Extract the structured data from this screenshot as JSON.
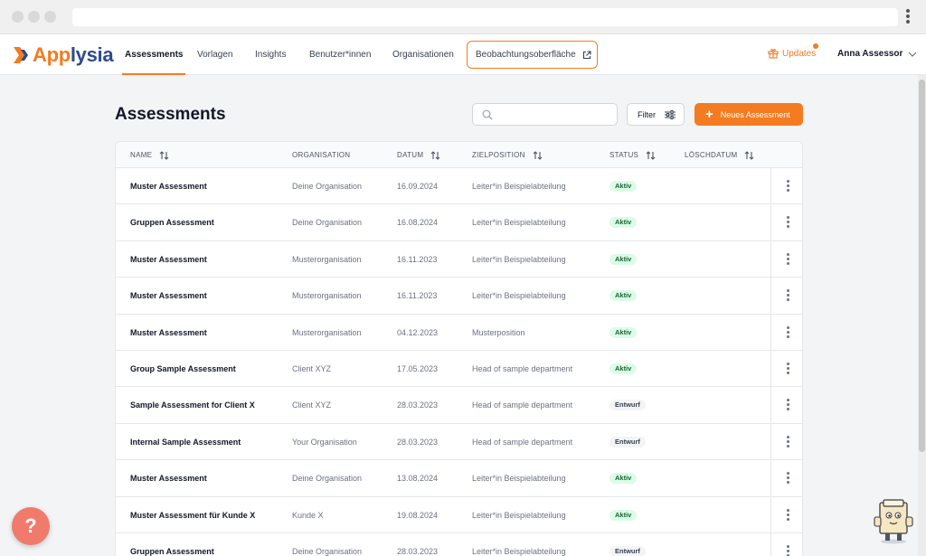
{
  "app": {
    "brand_part1": "App",
    "brand_part2": "lysia",
    "accent_color": "#f47b20",
    "brand_blue": "#2e4a8e"
  },
  "nav": {
    "items": [
      {
        "label": "Assessments",
        "active": true
      },
      {
        "label": "Vorlagen"
      },
      {
        "label": "Insights"
      },
      {
        "label": "Benutzer*innen"
      },
      {
        "label": "Organisationen"
      }
    ],
    "external": {
      "label": "Beobachtungsoberfläche",
      "icon": "external-link-icon"
    },
    "updates_label": "Updates",
    "user_name": "Anna Assessor"
  },
  "page": {
    "title": "Assessments",
    "search_placeholder": "",
    "filter_label": "Filter",
    "new_button_label": "Neues Assessment"
  },
  "table": {
    "columns": [
      "NAME",
      "ORGANISATION",
      "DATUM",
      "ZIELPOSITION",
      "STATUS",
      "LÖSCHDATUM"
    ],
    "rows": [
      {
        "name": "Muster Assessment",
        "org": "Deine Organisation",
        "date": "16.09.2024",
        "position": "Leiter*in Beispielabteilung",
        "status": "Aktiv"
      },
      {
        "name": "Gruppen Assessment",
        "org": "Deine Organisation",
        "date": "16.08.2024",
        "position": "Leiter*in Beispielabteilung",
        "status": "Aktiv"
      },
      {
        "name": "Muster Assessment",
        "org": "Musterorganisation",
        "date": "16.11.2023",
        "position": "Leiter*in Beispielabteilung",
        "status": "Aktiv"
      },
      {
        "name": "Muster Assessment",
        "org": "Musterorganisation",
        "date": "16.11.2023",
        "position": "Leiter*in Beispielabteilung",
        "status": "Aktiv"
      },
      {
        "name": "Muster Assessment",
        "org": "Musterorganisation",
        "date": "04.12.2023",
        "position": "Musterposition",
        "status": "Aktiv"
      },
      {
        "name": "Group Sample Assessment",
        "org": "Client XYZ",
        "date": "17.05.2023",
        "position": "Head of sample department",
        "status": "Aktiv"
      },
      {
        "name": "Sample Assessment for Client X",
        "org": "Client XYZ",
        "date": "28.03.2023",
        "position": "Head of sample department",
        "status": "Entwurf"
      },
      {
        "name": "Internal Sample Assessment",
        "org": "Your Organisation",
        "date": "28.03.2023",
        "position": "Head of sample department",
        "status": "Entwurf"
      },
      {
        "name": "Muster Assessment",
        "org": "Deine Organisation",
        "date": "13.08.2024",
        "position": "Leiter*in Beispielabteilung",
        "status": "Aktiv"
      },
      {
        "name": "Muster Assessment für Kunde X",
        "org": "Kunde X",
        "date": "19.08.2024",
        "position": "Leiter*in Beispielabteilung",
        "status": "Aktiv"
      },
      {
        "name": "Gruppen Assessment",
        "org": "Deine Organisation",
        "date": "28.03.2023",
        "position": "Leiter*in Beispielabteilung",
        "status": "Entwurf"
      }
    ]
  },
  "help": {
    "label": "?"
  }
}
